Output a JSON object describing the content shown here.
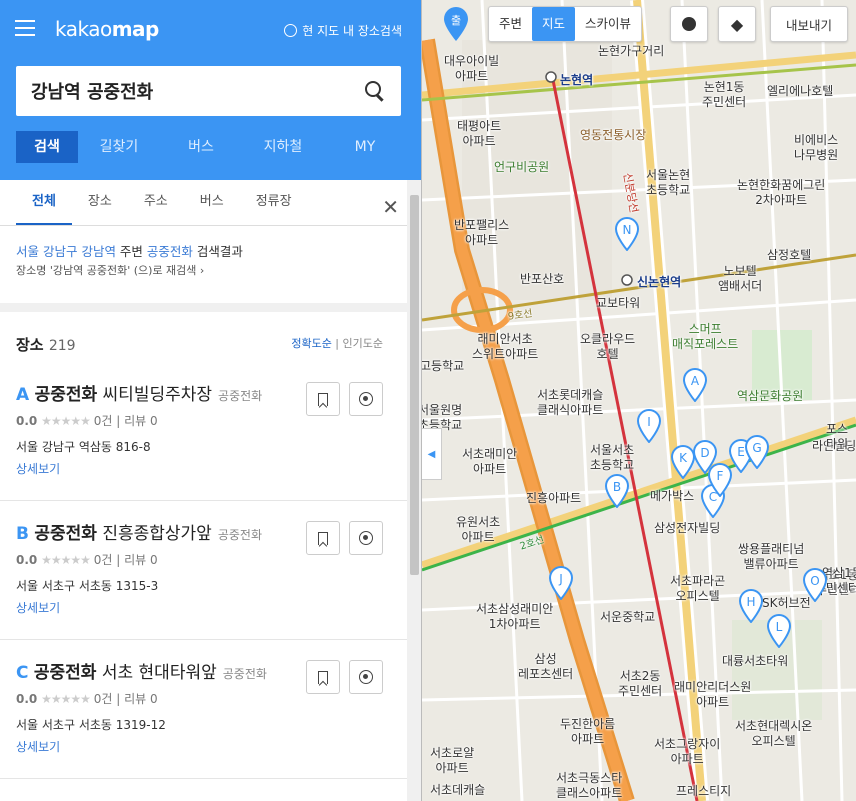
{
  "app": {
    "logo_light": "kakao",
    "logo_bold": "map",
    "area_search": "현 지도 내 장소검색"
  },
  "search": {
    "query": "강남역 공중전화"
  },
  "nav_tabs": [
    "검색",
    "길찾기",
    "버스",
    "지하철",
    "MY"
  ],
  "sub_tabs": [
    "전체",
    "장소",
    "주소",
    "버스",
    "정류장"
  ],
  "result_info": {
    "region": "서울 강남구 강남역",
    "mid": " 주변 ",
    "keyword": "공중전화",
    "tail": " 검색결과",
    "research": "장소명 '강남역 공중전화' (으)로 재검색"
  },
  "places": {
    "label": "장소",
    "count": "219",
    "sort_accuracy": "정확도순",
    "sort_popular": "인기도순",
    "items": [
      {
        "letter": "A",
        "name": "공중전화",
        "rest": " 씨티빌딩주차장",
        "category": "공중전화",
        "score": "0.0",
        "stars": "★★★★★",
        "count": "0건",
        "review": "리뷰 0",
        "address": "서울 강남구 역삼동 816-8",
        "detail": "상세보기"
      },
      {
        "letter": "B",
        "name": "공중전화",
        "rest": " 진흥종합상가앞",
        "category": "공중전화",
        "score": "0.0",
        "stars": "★★★★★",
        "count": "0건",
        "review": "리뷰 0",
        "address": "서울 서초구 서초동 1315-3",
        "detail": "상세보기"
      },
      {
        "letter": "C",
        "name": "공중전화",
        "rest": " 서초 현대타워앞",
        "category": "공중전화",
        "score": "0.0",
        "stars": "★★★★★",
        "count": "0건",
        "review": "리뷰 0",
        "address": "서울 서초구 서초동 1319-12",
        "detail": "상세보기"
      }
    ]
  },
  "map_toolbar": {
    "nearby": "주변",
    "map": "지도",
    "skyview": "스카이뷰",
    "export": "내보내기",
    "start": "출"
  },
  "map_labels": {
    "l1": "대우아이빌\n아파트",
    "l2": "논현역",
    "l3": "논현1동\n주민센터",
    "l4": "엘리에나호텔",
    "l5": "태평아트\n아파트",
    "l6": "영동전통시장",
    "l7": "비에비스\n나무병원",
    "l8": "언구비공원",
    "l9": "서울논현\n초등학교",
    "l10": "논현한화꿈에그린\n2차아파트",
    "l11": "반포팰리스\n아파트",
    "l12": "삼정호텔",
    "l13": "반포산호",
    "l14": "신논현역",
    "l15": "노보텔\n앰배서더",
    "l16": "교보타워",
    "l17": "스머프\n매직포레스트",
    "l18": "래미안서초\n스위트아파트",
    "l19": "오클라우드\n호텔",
    "l20": "서초롯데캐슬\n클래식아파트",
    "l21": "역삼문화공원",
    "l22": "서울원명\n초등학교",
    "l23": "서울서초\n초등학교",
    "l24": "서초래미안\n아파트",
    "l25": "라인빌딩",
    "l26": "메가박스",
    "l27": "진흥아파트",
    "l28": "삼성전자빌딩",
    "l29": "유원서초\n아파트",
    "l30": "쌍용플래티넘\n밸류아파트",
    "l31": "서초파라곤\n오피스텔",
    "l32": "서초삼성래미안\n1차아파트",
    "l33": "서운중학교",
    "l34": "SK허브전",
    "l35": "대륭서초타워",
    "l36": "삼성\n레포츠센터",
    "l37": "서초2동\n주민센터",
    "l38": "래미안리더스원\n아파트",
    "l39": "두진한아름\n아파트",
    "l40": "서초현대렉시온\n오피스텔",
    "l41": "서초1동\n주민센터",
    "l42": "서초그랑자이\n아파트",
    "l43": "서초로얄\n아파트",
    "l44": "서초극동스타\n클래스아파트",
    "l45": "프레스티지",
    "l46": "고등학교",
    "l47": "논현가구거리",
    "l48": "신분당선",
    "l49": "9호선",
    "l50": "2호선",
    "l51": "역삼1동\n민센터",
    "l52": "서초데캐슬",
    "l53": "포스\n타워"
  },
  "pins": [
    "A",
    "B",
    "C",
    "D",
    "E",
    "F",
    "G",
    "H",
    "I",
    "J",
    "K",
    "L",
    "N",
    "O"
  ]
}
